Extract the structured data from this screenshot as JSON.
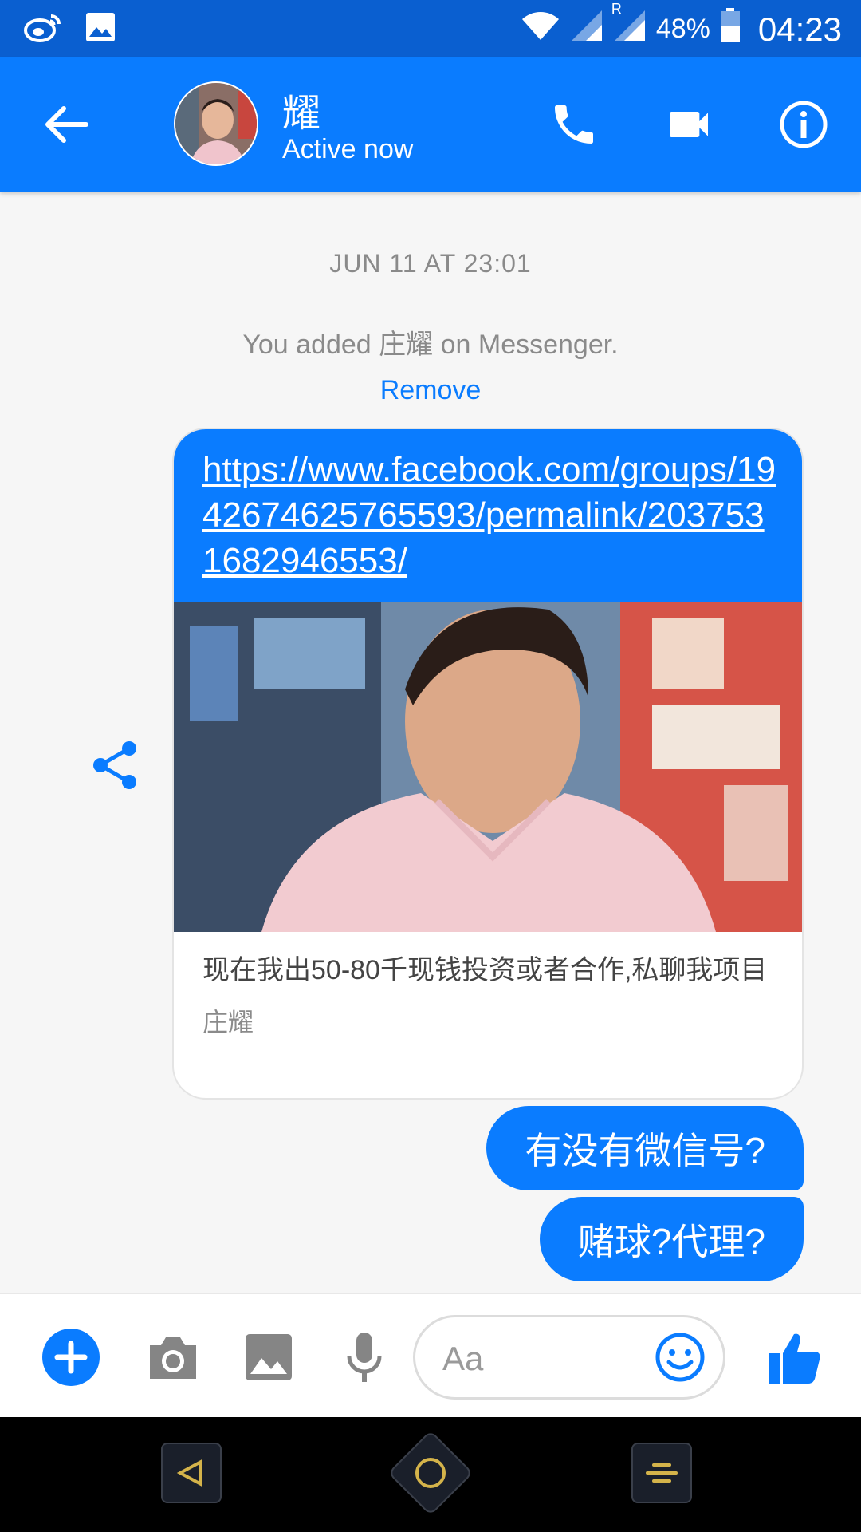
{
  "status_bar": {
    "battery": "48%",
    "time": "04:23",
    "roaming": "R"
  },
  "header": {
    "contact_name": "耀",
    "status": "Active now"
  },
  "chat": {
    "timestamp": "JUN 11 AT 23:01",
    "added_notice": "You added 庄耀 on Messenger.",
    "remove_label": "Remove",
    "shared_link": {
      "url": "https://www.facebook.com/groups/1942674625765593/permalink/2037531682946553/",
      "title": "现在我出50-80千现钱投资或者合作,私聊我项目",
      "source": "庄耀"
    },
    "messages": [
      {
        "text": "有没有微信号?"
      },
      {
        "text": "赌球?代理?"
      }
    ]
  },
  "composer": {
    "placeholder": "Aa"
  },
  "colors": {
    "accent": "#0a7cff",
    "status_bar": "#0a5fd0"
  }
}
